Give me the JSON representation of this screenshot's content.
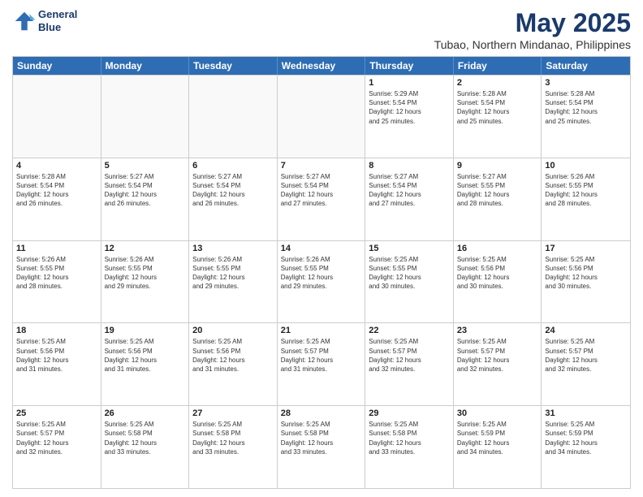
{
  "header": {
    "logo_line1": "General",
    "logo_line2": "Blue",
    "month": "May 2025",
    "location": "Tubao, Northern Mindanao, Philippines"
  },
  "days_of_week": [
    "Sunday",
    "Monday",
    "Tuesday",
    "Wednesday",
    "Thursday",
    "Friday",
    "Saturday"
  ],
  "weeks": [
    [
      {
        "day": "",
        "info": "",
        "empty": true
      },
      {
        "day": "",
        "info": "",
        "empty": true
      },
      {
        "day": "",
        "info": "",
        "empty": true
      },
      {
        "day": "",
        "info": "",
        "empty": true
      },
      {
        "day": "1",
        "info": "Sunrise: 5:29 AM\nSunset: 5:54 PM\nDaylight: 12 hours\nand 25 minutes."
      },
      {
        "day": "2",
        "info": "Sunrise: 5:28 AM\nSunset: 5:54 PM\nDaylight: 12 hours\nand 25 minutes."
      },
      {
        "day": "3",
        "info": "Sunrise: 5:28 AM\nSunset: 5:54 PM\nDaylight: 12 hours\nand 25 minutes."
      }
    ],
    [
      {
        "day": "4",
        "info": "Sunrise: 5:28 AM\nSunset: 5:54 PM\nDaylight: 12 hours\nand 26 minutes."
      },
      {
        "day": "5",
        "info": "Sunrise: 5:27 AM\nSunset: 5:54 PM\nDaylight: 12 hours\nand 26 minutes."
      },
      {
        "day": "6",
        "info": "Sunrise: 5:27 AM\nSunset: 5:54 PM\nDaylight: 12 hours\nand 26 minutes."
      },
      {
        "day": "7",
        "info": "Sunrise: 5:27 AM\nSunset: 5:54 PM\nDaylight: 12 hours\nand 27 minutes."
      },
      {
        "day": "8",
        "info": "Sunrise: 5:27 AM\nSunset: 5:54 PM\nDaylight: 12 hours\nand 27 minutes."
      },
      {
        "day": "9",
        "info": "Sunrise: 5:27 AM\nSunset: 5:55 PM\nDaylight: 12 hours\nand 28 minutes."
      },
      {
        "day": "10",
        "info": "Sunrise: 5:26 AM\nSunset: 5:55 PM\nDaylight: 12 hours\nand 28 minutes."
      }
    ],
    [
      {
        "day": "11",
        "info": "Sunrise: 5:26 AM\nSunset: 5:55 PM\nDaylight: 12 hours\nand 28 minutes."
      },
      {
        "day": "12",
        "info": "Sunrise: 5:26 AM\nSunset: 5:55 PM\nDaylight: 12 hours\nand 29 minutes."
      },
      {
        "day": "13",
        "info": "Sunrise: 5:26 AM\nSunset: 5:55 PM\nDaylight: 12 hours\nand 29 minutes."
      },
      {
        "day": "14",
        "info": "Sunrise: 5:26 AM\nSunset: 5:55 PM\nDaylight: 12 hours\nand 29 minutes."
      },
      {
        "day": "15",
        "info": "Sunrise: 5:25 AM\nSunset: 5:55 PM\nDaylight: 12 hours\nand 30 minutes."
      },
      {
        "day": "16",
        "info": "Sunrise: 5:25 AM\nSunset: 5:56 PM\nDaylight: 12 hours\nand 30 minutes."
      },
      {
        "day": "17",
        "info": "Sunrise: 5:25 AM\nSunset: 5:56 PM\nDaylight: 12 hours\nand 30 minutes."
      }
    ],
    [
      {
        "day": "18",
        "info": "Sunrise: 5:25 AM\nSunset: 5:56 PM\nDaylight: 12 hours\nand 31 minutes."
      },
      {
        "day": "19",
        "info": "Sunrise: 5:25 AM\nSunset: 5:56 PM\nDaylight: 12 hours\nand 31 minutes."
      },
      {
        "day": "20",
        "info": "Sunrise: 5:25 AM\nSunset: 5:56 PM\nDaylight: 12 hours\nand 31 minutes."
      },
      {
        "day": "21",
        "info": "Sunrise: 5:25 AM\nSunset: 5:57 PM\nDaylight: 12 hours\nand 31 minutes."
      },
      {
        "day": "22",
        "info": "Sunrise: 5:25 AM\nSunset: 5:57 PM\nDaylight: 12 hours\nand 32 minutes."
      },
      {
        "day": "23",
        "info": "Sunrise: 5:25 AM\nSunset: 5:57 PM\nDaylight: 12 hours\nand 32 minutes."
      },
      {
        "day": "24",
        "info": "Sunrise: 5:25 AM\nSunset: 5:57 PM\nDaylight: 12 hours\nand 32 minutes."
      }
    ],
    [
      {
        "day": "25",
        "info": "Sunrise: 5:25 AM\nSunset: 5:57 PM\nDaylight: 12 hours\nand 32 minutes."
      },
      {
        "day": "26",
        "info": "Sunrise: 5:25 AM\nSunset: 5:58 PM\nDaylight: 12 hours\nand 33 minutes."
      },
      {
        "day": "27",
        "info": "Sunrise: 5:25 AM\nSunset: 5:58 PM\nDaylight: 12 hours\nand 33 minutes."
      },
      {
        "day": "28",
        "info": "Sunrise: 5:25 AM\nSunset: 5:58 PM\nDaylight: 12 hours\nand 33 minutes."
      },
      {
        "day": "29",
        "info": "Sunrise: 5:25 AM\nSunset: 5:58 PM\nDaylight: 12 hours\nand 33 minutes."
      },
      {
        "day": "30",
        "info": "Sunrise: 5:25 AM\nSunset: 5:59 PM\nDaylight: 12 hours\nand 34 minutes."
      },
      {
        "day": "31",
        "info": "Sunrise: 5:25 AM\nSunset: 5:59 PM\nDaylight: 12 hours\nand 34 minutes."
      }
    ]
  ]
}
